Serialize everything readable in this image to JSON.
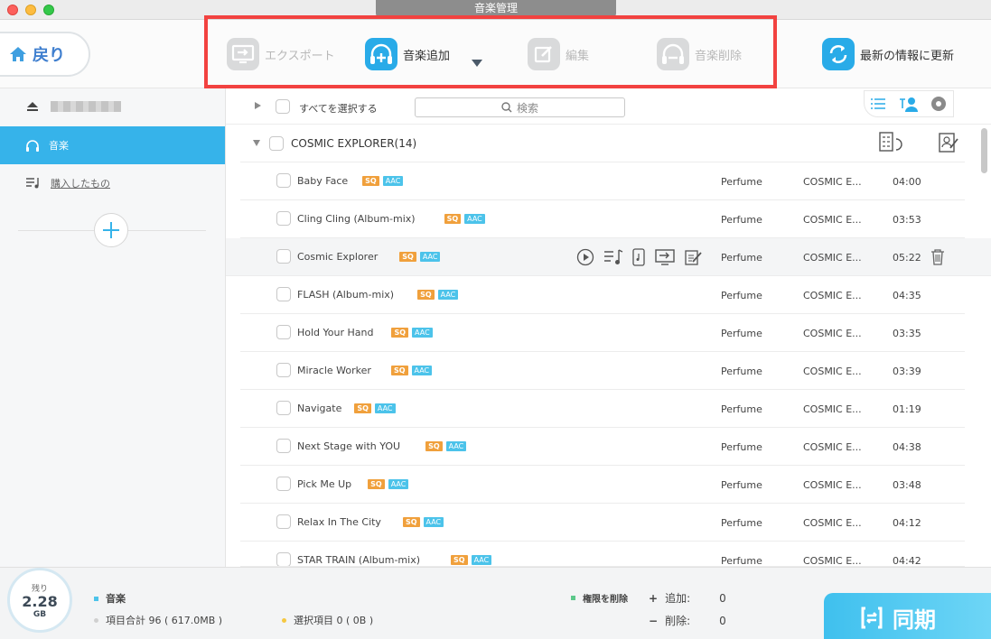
{
  "window": {
    "title": "音楽管理"
  },
  "toolbar": {
    "back_label": "戻り",
    "export_label": "エクスポート",
    "add_label": "音楽追加",
    "edit_label": "編集",
    "delete_label": "音楽削除",
    "refresh_label": "最新の情報に更新"
  },
  "sidebar": {
    "music_label": "音楽",
    "purchased_label": "購入したもの"
  },
  "filter": {
    "select_all_label": "すべてを選択する",
    "search_placeholder": "検索"
  },
  "album": {
    "title": "COSMIC EXPLORER(14)"
  },
  "tracks": [
    {
      "name": "Baby Face",
      "badges": [
        "SQ",
        "AAC"
      ],
      "artist": "Perfume",
      "album": "COSMIC E...",
      "duration": "04:00"
    },
    {
      "name": "Cling Cling (Album-mix)",
      "badges": [
        "SQ",
        "AAC"
      ],
      "artist": "Perfume",
      "album": "COSMIC E...",
      "duration": "03:53"
    },
    {
      "name": "Cosmic Explorer",
      "badges": [
        "SQ",
        "AAC"
      ],
      "artist": "Perfume",
      "album": "COSMIC E...",
      "duration": "05:22"
    },
    {
      "name": "FLASH (Album-mix)",
      "badges": [
        "SQ",
        "AAC"
      ],
      "artist": "Perfume",
      "album": "COSMIC E...",
      "duration": "04:35"
    },
    {
      "name": "Hold Your Hand",
      "badges": [
        "SQ",
        "AAC"
      ],
      "artist": "Perfume",
      "album": "COSMIC E...",
      "duration": "03:35"
    },
    {
      "name": "Miracle Worker",
      "badges": [
        "SQ",
        "AAC"
      ],
      "artist": "Perfume",
      "album": "COSMIC E...",
      "duration": "03:39"
    },
    {
      "name": "Navigate",
      "badges": [
        "SQ",
        "AAC"
      ],
      "artist": "Perfume",
      "album": "COSMIC E...",
      "duration": "01:19"
    },
    {
      "name": "Next Stage with YOU",
      "badges": [
        "SQ",
        "AAC"
      ],
      "artist": "Perfume",
      "album": "COSMIC E...",
      "duration": "04:38"
    },
    {
      "name": "Pick Me Up",
      "badges": [
        "SQ",
        "AAC"
      ],
      "artist": "Perfume",
      "album": "COSMIC E...",
      "duration": "03:48"
    },
    {
      "name": "Relax In The City",
      "badges": [
        "SQ",
        "AAC"
      ],
      "artist": "Perfume",
      "album": "COSMIC E...",
      "duration": "04:12"
    },
    {
      "name": "STAR TRAIN (Album-mix)",
      "badges": [
        "SQ",
        "AAC"
      ],
      "artist": "Perfume",
      "album": "COSMIC E...",
      "duration": "04:42"
    }
  ],
  "storage": {
    "remaining_label": "残り",
    "value": "2.28",
    "unit": "GB"
  },
  "status": {
    "category": "音楽",
    "total_items": "項目合計 96 ( 617.0MB )",
    "selected_items": "選択項目 0 ( 0B )",
    "permission_delete": "権限を削除",
    "add_label": "追加:",
    "add_count": "0",
    "delete_label": "削除:",
    "delete_count": "0"
  },
  "sync": {
    "label": "同期"
  },
  "colors": {
    "accent": "#29abe8",
    "highlight": "#f24240",
    "sq": "#f0a03c",
    "aac": "#4cc3ea"
  }
}
